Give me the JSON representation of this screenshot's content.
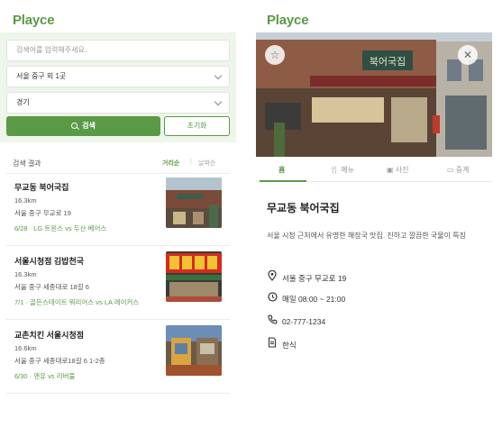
{
  "app": {
    "logo": "Playce"
  },
  "search": {
    "placeholder": "검색어를 입력해주세요.",
    "location_select": "서울 중구 외 1곳",
    "region_select": "경기",
    "search_button": "검색",
    "reset_button": "초기화"
  },
  "results": {
    "header": "검색 결과",
    "sort_active": "거리순",
    "sort_separator": "|",
    "sort_inactive": "날짜순",
    "items": [
      {
        "name": "무교동 북어국집",
        "distance": "16.3km",
        "address": "서울 중구 무교로 19",
        "event": "6/28 · LG 트윈스 vs 두산 베어스"
      },
      {
        "name": "서울시청점 김밥천국",
        "distance": "16.3km",
        "address": "서울 중구 세종대로 18길 6",
        "event": "7/1 · 골든스테이트 워리어스 vs LA 레이커스"
      },
      {
        "name": "교촌치킨 서울시청점",
        "distance": "16.6km",
        "address": "서울 중구 세종대로18길 6 1-2층",
        "event": "6/30 · 맨유 vs 리버풀"
      }
    ]
  },
  "detail": {
    "tabs": [
      "홈",
      "메뉴",
      "사진",
      "중계"
    ],
    "name": "무교동 북어국집",
    "description": "서울 시청 근처에서 유명한 해장국 맛집. 진하고 깔끔한 국물이 특징",
    "address": "서울 중구 무교로 19",
    "hours": "매일 08:00 ~ 21:00",
    "phone": "02-777-1234",
    "category": "한식",
    "store_sign": "북어국집"
  },
  "colors": {
    "accent": "#5a9a47",
    "search_bg": "#eef5ea"
  },
  "icons": {
    "favorite": "star-icon",
    "close": "close-icon",
    "location": "pin-icon",
    "hours": "clock-icon",
    "phone": "phone-icon",
    "category": "document-icon"
  }
}
